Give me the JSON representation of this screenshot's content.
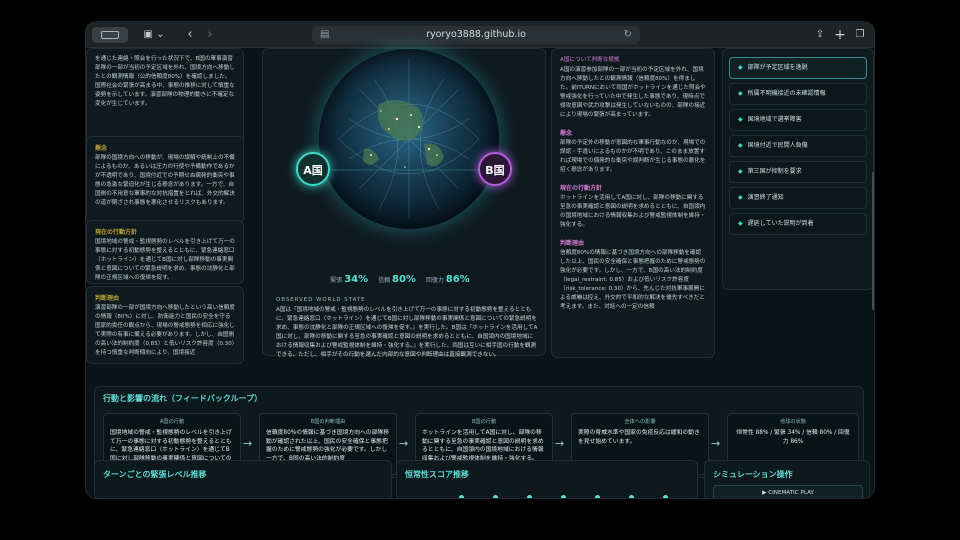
{
  "browser": {
    "url": "ryoryo3888.github.io"
  },
  "left_panel": {
    "intro": "を通じた連絡・照会を行った状況下で、B国の軍事演習部隊の一部が当初の予定区域を外れ、国境方向へ移動したとの観測情報（公的信頼度80%）を確認しました。国際社会の緊張が高まる中、事態の推移に対して慎重な姿勢を示しています。演習部隊の物理的動きに不確定な変化が生じています。",
    "sections": [
      {
        "title": "懸念",
        "text": "部隊の国境方向への移動が、現場の誤解や統制上の不備によるものか、あるいは圧力の行使や予備動作であるかが不透明であり、国境付近での予期せぬ偶発的衝突や事態の急激な緊迫化が生じる懸念があります。一方で、自国側の不用意な軍事的な対抗措置をとれば、外交的解決の道が閉ざされ事態を悪化させるリスクもあります。"
      },
      {
        "title": "現在の行動方針",
        "text": "国境地域の警戒・監視態勢のレベルを引き上げて万一の事態に対する初動態勢を整えるとともに、緊急連絡窓口（ホットライン）を通じてB国に対し部隊移動の事実関係と意図についての緊急説明を求め、事態の沈静化と部隊の正規区域への復帰を促す。"
      },
      {
        "title": "判断理由",
        "text": "演習部隊の一部が国境方向へ移動したという高い信頼度の情報（80%）に対し、防衛能力と国民の安全を守る国家的責任の観点から、現場の警戒態勢を相応に強化して実際の有事に備える必要があります。しかし、自国側の高い法的制約度（0.85）と低いリスク許容度（0.30）を持つ慎重な判断傾向により、国境接近"
      }
    ]
  },
  "center": {
    "badge_a": "A国",
    "badge_b": "B国",
    "stats": [
      {
        "label": "緊張",
        "value": "34%"
      },
      {
        "label": "信頼",
        "value": "80%"
      },
      {
        "label": "回復力",
        "value": "86%"
      }
    ],
    "observed_title": "OBSERVED WORLD STATE",
    "observed_text": "A国は『国境地域の警戒・監視態勢のレベルを引き上げて万一の事態に対する初動態勢を整えるとともに、緊急連絡窓口（ホットライン）を通じてB国に対し部隊移動の事実関係と意図についての緊急説明を求め、事態の沈静化と部隊の正規区域への復帰を促す。』を実行した。B国は『ホットラインを活用してA国に対し、部隊の移動に関する至急の事実確認と意図の説明を求めるとともに、自国領内の国境地域における情報収集および警戒監視体制を維持・強化する。』を実行した。両国は互いに相手国の行動を観測できる。ただし、相手がその行動を選んだ内部的な意図や判断理由は直接観測できない。"
  },
  "right_panel": {
    "head": "A国について判断な根拠",
    "intro": "A国の演習参加部隊の一部が当初の予定区域を外れ、国境方向へ移動したとの観測情報（信頼度80%）を得ました。前ITURNにおいて両国がホットラインを通じた照会や警戒強化を行っていた中で発生した事態であり、現時点で侵攻意図や武力攻撃は発生していないものの、部隊の接近により現場の緊張が高まっています。",
    "sections": [
      {
        "title": "懸念",
        "text": "部隊の予定外の移動が意図的な軍事行動なのか、現場での誤認・手違いによるものかが不明であり、このまま放置すれば現場での偶発的な衝突や誤判断が生じる事態の悪化を招く懸念があります。"
      },
      {
        "title": "現在の行動方針",
        "text": "ホットラインを活用してA国に対し、部隊の移動に関する至急の事実確認と意図の説明を求めるとともに、自国領内の国境地域における情報収集および警戒監視体制を維持・強化する。"
      },
      {
        "title": "判断理由",
        "text": "信頼度80%の情報に基づき国境方向への部隊移動を確認した以上、国民の安全確保と事態把握のために警戒態勢の強化が必要です。しかし、一方で、B国の高い法的制約度（legal_restraint: 0.85）および低いリスク許容度（risk_tolerance: 0.30）から、先んじた対抗軍事展開による威嚇は控え、外交的で平和的な解決を優先すべきだと考えます。また、対話への一定の信頼"
      }
    ]
  },
  "event_list": [
    {
      "label": "部隊が予定区域を逸脱",
      "active": true
    },
    {
      "label": "所属不明機接近の未確認情報",
      "active": false
    },
    {
      "label": "国境地域で選挙障害",
      "active": false
    },
    {
      "label": "国境付近で民間人負傷",
      "active": false
    },
    {
      "label": "第三国が抑制を要求",
      "active": false
    },
    {
      "label": "演習終了通知",
      "active": false
    },
    {
      "label": "遅延していた説明が到着",
      "active": false
    }
  ],
  "flow": {
    "title": "行動と影響の流れ（フィードバックループ）",
    "cards": [
      {
        "title": "A国の行動",
        "body": "国境地域の警戒・監視態勢のレベルを引き上げて万一の事態に対する初動態勢を整えるとともに、緊急連絡窓口（ホットライン）を通じてB国に対し部隊移動の事実関係と意図についての緊急説明を求め、事態の沈静化と部隊の正規区域への..."
      },
      {
        "title": "B国の判断理由",
        "body": "信頼度80%の情報に基づき国境方向への部隊移動が確認された以上、国民の安全確保と事態把握のために警戒態勢の強化が必要です。しかし一方で、B国の高い法的制約度（legal_restraint: 0.85）および低い許容..."
      },
      {
        "title": "B国の行動",
        "body": "ホットラインを活用してA国に対し、部隊の移動に関する至急の事実確認と意図の説明を求めるとともに、自国領内の国境地域における情報収集および警戒監視体制を維持・強化する。"
      },
      {
        "title": "全体への影響",
        "body": "実際の脅威水準や国家の免疫反応は緩和の動きを見せ始めています。"
      },
      {
        "title": "他球の状態",
        "body": "恒常性 88% / 緊張 34% / 信頼 80% / 回復力 86%"
      }
    ]
  },
  "bottom": {
    "turn_title": "ターンごとの緊張レベル推移",
    "score_title": "恒常性スコア推移",
    "sim_title": "シミュレーション操作",
    "play_label": "▶ CINEMATIC PLAY"
  }
}
